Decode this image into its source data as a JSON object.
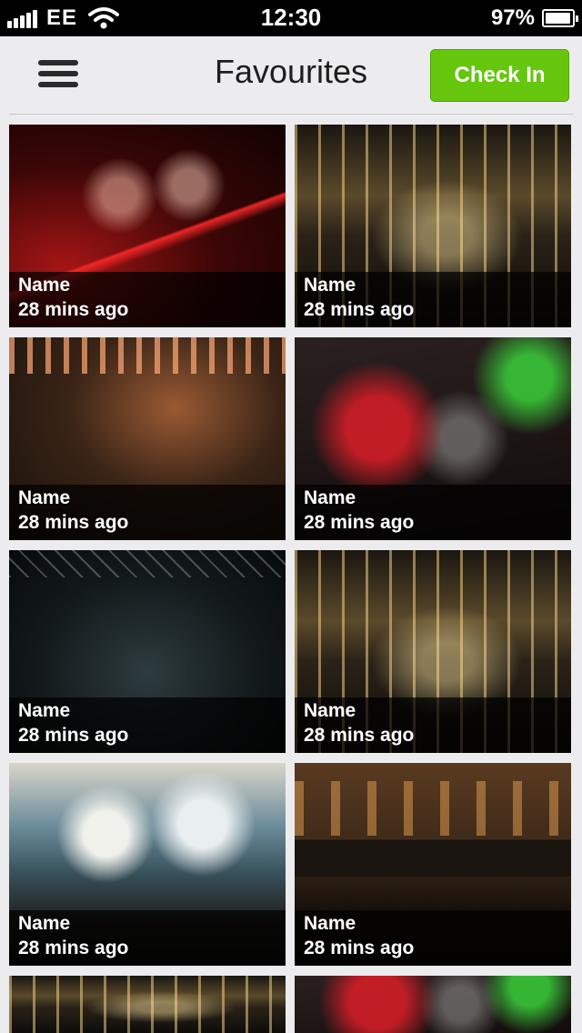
{
  "status_bar": {
    "carrier": "EE",
    "time": "12:30",
    "battery_percent": "97%",
    "battery_level": 0.97,
    "signal_bars": 5
  },
  "header": {
    "title": "Favourites",
    "check_in_label": "Check In",
    "check_in_color": "#66c60e"
  },
  "tiles": [
    {
      "name": "Name",
      "time": "28 mins ago"
    },
    {
      "name": "Name",
      "time": "28 mins ago"
    },
    {
      "name": "Name",
      "time": "28 mins ago"
    },
    {
      "name": "Name",
      "time": "28 mins ago"
    },
    {
      "name": "Name",
      "time": "28 mins ago"
    },
    {
      "name": "Name",
      "time": "28 mins ago"
    },
    {
      "name": "Name",
      "time": "28 mins ago"
    },
    {
      "name": "Name",
      "time": "28 mins ago"
    }
  ]
}
